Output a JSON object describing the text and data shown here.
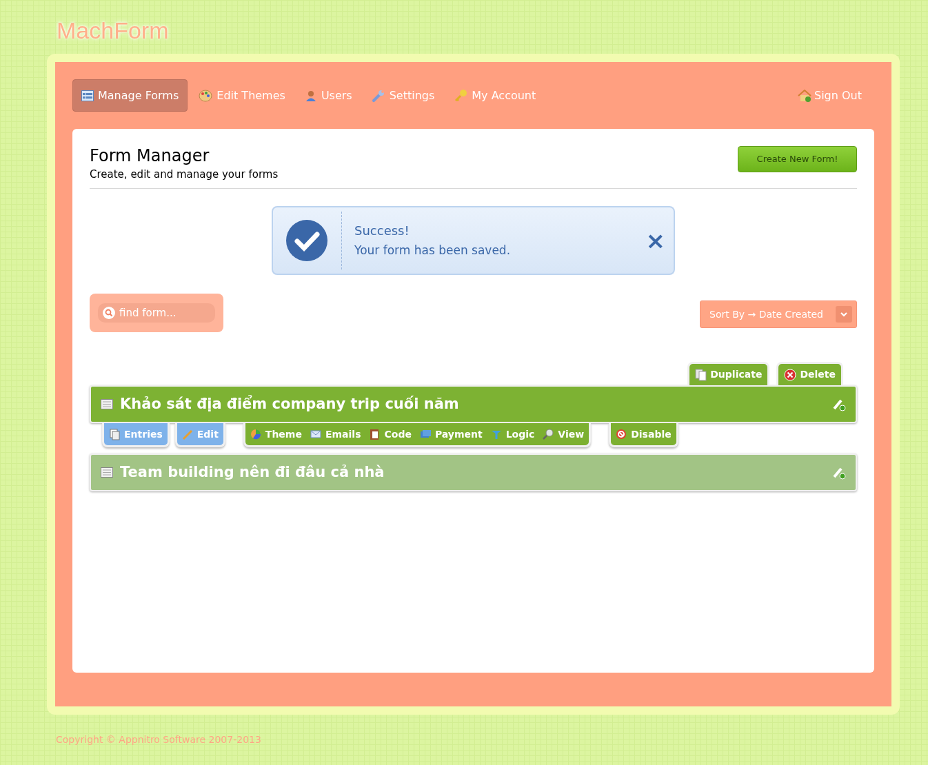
{
  "logo": "MachForm",
  "nav": [
    {
      "label": "Manage Forms",
      "selected": true
    },
    {
      "label": "Edit Themes",
      "selected": false
    },
    {
      "label": "Users",
      "selected": false
    },
    {
      "label": "Settings",
      "selected": false
    },
    {
      "label": "My Account",
      "selected": false
    }
  ],
  "sign_out": "Sign Out",
  "header": {
    "title": "Form Manager",
    "subtitle": "Create, edit and manage your forms",
    "create_button": "Create New Form!"
  },
  "alert": {
    "title": "Success!",
    "message": "Your form has been saved.",
    "close": "×"
  },
  "search": {
    "placeholder": "find form..."
  },
  "sort": {
    "label": "Sort By → Date Created"
  },
  "row_actions": [
    "Duplicate",
    "Delete"
  ],
  "forms": [
    {
      "title": "Khảo sát địa điểm company trip cuối năm",
      "selected": true,
      "action_groups": [
        {
          "kind": "primary",
          "buttons": [
            "Entries"
          ]
        },
        {
          "kind": "primary",
          "buttons": [
            "Edit"
          ]
        },
        {
          "kind": "secondary",
          "buttons": [
            "Theme",
            "Emails",
            "Code",
            "Payment",
            "Logic",
            "View"
          ]
        },
        {
          "kind": "secondary",
          "buttons": [
            "Disable"
          ]
        }
      ]
    },
    {
      "title": "Team building nên đi đâu cả nhà",
      "selected": false
    }
  ],
  "footer": "Copyright © Appnitro Software 2007-2013"
}
